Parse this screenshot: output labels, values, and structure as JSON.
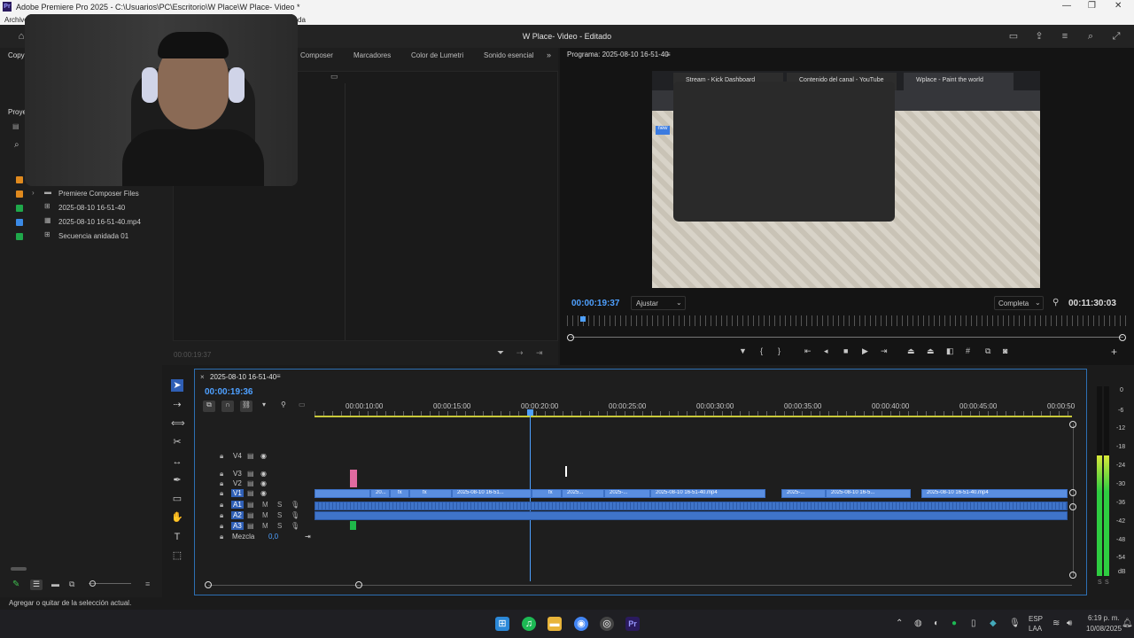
{
  "window": {
    "title": "Adobe Premiere Pro 2025 - C:\\Usuarios\\PC\\Escritorio\\W Place\\W Place- Video *",
    "controls": [
      "—",
      "❐",
      "✕"
    ]
  },
  "menubar": {
    "left": "Archivo",
    "right": "da"
  },
  "header": {
    "doc_title": "W Place- Video - Editado"
  },
  "left_panel": {
    "copy_label": "Copy l",
    "project_label": "Proye",
    "bins": [
      {
        "name": "Premiere Composer Files",
        "color": "#e08a1e",
        "icon": "folder-icon"
      },
      {
        "name": "2025-08-10 16-51-40",
        "color": "#1fa84a",
        "icon": "sequence-icon"
      },
      {
        "name": "2025-08-10 16-51-40.mp4",
        "color": "#3b8ae6",
        "icon": "media-icon"
      },
      {
        "name": "Secuencia anidada 01",
        "color": "#1fa84a",
        "icon": "sequence-icon"
      }
    ]
  },
  "source_panel": {
    "tabs": [
      "Composer",
      "Marcadores",
      "Color de Lumetri",
      "Sonido esencial"
    ],
    "timecode": "00:00:19:37"
  },
  "program": {
    "title": "Programa: 2025-08-10 16-51-40",
    "timecode": "00:00:19:37",
    "fit": "Ajustar",
    "quality": "Completa",
    "duration": "00:11:30:03",
    "browser_tabs": [
      "Stream - Kick Dashboard",
      "Contenido del canal - YouTube",
      "Wplace - Paint the world"
    ],
    "browser_badge": "new"
  },
  "timeline": {
    "sequence_name": "2025-08-10 16-51-40",
    "timecode": "00:00:19:36",
    "ruler": [
      "00:00:10:00",
      "00:00:15:00",
      "00:00:20:00",
      "00:00:25:00",
      "00:00:30:00",
      "00:00:35:00",
      "00:00:40:00",
      "00:00:45:00",
      "00:00:50"
    ],
    "video_tracks": [
      "V4",
      "V3",
      "V2",
      "V1"
    ],
    "audio_tracks": [
      "A1",
      "A2",
      "A3"
    ],
    "mix_label": "Mezcla",
    "mix_value": "0,0",
    "clips": [
      "20...",
      "fx",
      "fx",
      "2025-08-10 16-51...",
      "fx",
      "2025...",
      "2025-...",
      "2025-08-10 16-51-40.mp4",
      "2025-...",
      "2025-08-10 16-5...",
      "2025-08-10 16-51-40.mp4"
    ]
  },
  "meter": {
    "labels": [
      "0",
      "-6",
      "-12",
      "-18",
      "-24",
      "-30",
      "-36",
      "-42",
      "-48",
      "-54",
      "dB"
    ],
    "solo": [
      "S",
      "S"
    ],
    "level_left": 0.7,
    "level_right": 0.7
  },
  "status": {
    "text": "Agregar o quitar de la selección actual."
  },
  "taskbar": {
    "lang": "ESP",
    "lang2": "LAA",
    "time": "6:19 p. m.",
    "date": "10/08/2025"
  }
}
